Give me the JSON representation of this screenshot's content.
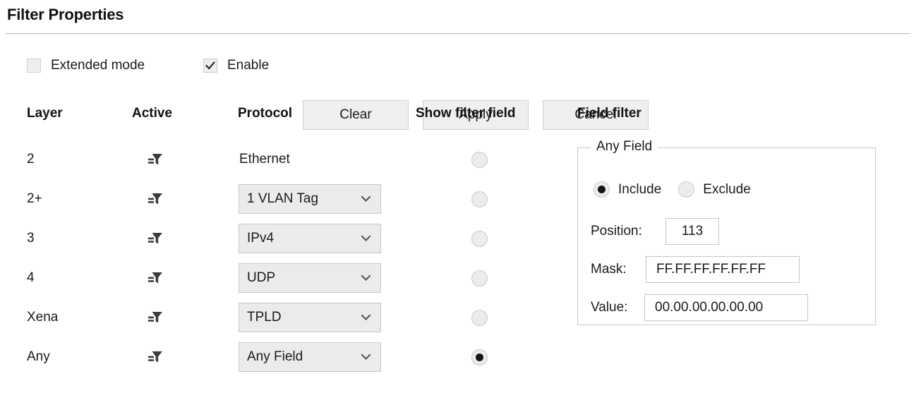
{
  "panel": {
    "title": "Filter Properties"
  },
  "toolbar": {
    "extended_mode": {
      "label": "Extended mode",
      "checked": false
    },
    "enable": {
      "label": "Enable",
      "checked": true
    },
    "clear_label": "Clear",
    "apply_label": "Apply",
    "cancel_label": "Cancel"
  },
  "table": {
    "headers": {
      "layer": "Layer",
      "active": "Active",
      "protocol": "Protocol",
      "show_filter_field": "Show filter field",
      "field_filter": "Field filter"
    },
    "rows": [
      {
        "layer": "2",
        "active_icon": "filter-funnel-icon",
        "protocol": "Ethernet",
        "protocol_is_combo": false,
        "show_filter_field_selected": false
      },
      {
        "layer": "2+",
        "active_icon": "filter-funnel-icon",
        "protocol": "1 VLAN Tag",
        "protocol_is_combo": true,
        "show_filter_field_selected": false
      },
      {
        "layer": "3",
        "active_icon": "filter-funnel-icon",
        "protocol": "IPv4",
        "protocol_is_combo": true,
        "show_filter_field_selected": false
      },
      {
        "layer": "4",
        "active_icon": "filter-funnel-icon",
        "protocol": "UDP",
        "protocol_is_combo": true,
        "show_filter_field_selected": false
      },
      {
        "layer": "Xena",
        "active_icon": "filter-funnel-icon",
        "protocol": "TPLD",
        "protocol_is_combo": true,
        "show_filter_field_selected": false
      },
      {
        "layer": "Any",
        "active_icon": "filter-funnel-icon",
        "protocol": "Any Field",
        "protocol_is_combo": true,
        "show_filter_field_selected": true
      }
    ]
  },
  "field_filter": {
    "legend": "Any Field",
    "include": {
      "label": "Include",
      "selected": true
    },
    "exclude": {
      "label": "Exclude",
      "selected": false
    },
    "position": {
      "label": "Position:",
      "value": "113"
    },
    "mask": {
      "label": "Mask:",
      "value": "FF.FF.FF.FF.FF.FF"
    },
    "value": {
      "label": "Value:",
      "value": "00.00.00.00.00.00"
    }
  },
  "colors": {
    "background": "#ffffff",
    "text": "#1a1a1a",
    "rule": "#b5b5b5",
    "button_face": "#efefef",
    "button_border": "#cfcfcf",
    "combo_face": "#ebebeb",
    "combo_border": "#c8c8c8",
    "control_border": "#c6c6c6",
    "icon_dark": "#3c3c3c",
    "radio_dot": "#151515"
  }
}
